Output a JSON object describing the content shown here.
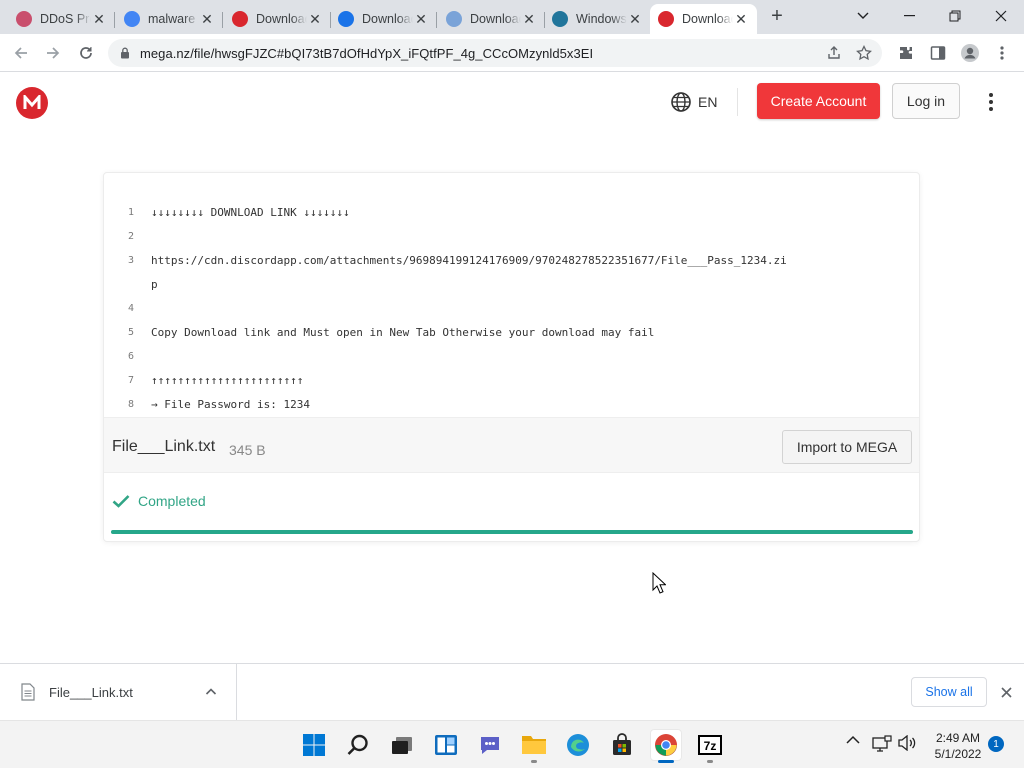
{
  "browser": {
    "tabs": [
      {
        "title": "DDoS Pro",
        "favicon": "ddos-favicon-icon",
        "fav_color": "#c94f6d"
      },
      {
        "title": "malware",
        "favicon": "google-favicon-icon",
        "fav_color": "#4285f4"
      },
      {
        "title": "Download",
        "favicon": "mega-favicon-icon",
        "fav_color": "#d9272e"
      },
      {
        "title": "Download",
        "favicon": "download-favicon-icon",
        "fav_color": "#1a73e8"
      },
      {
        "title": "Download",
        "favicon": "globe-favicon-icon",
        "fav_color": "#7aa3d8"
      },
      {
        "title": "Windows",
        "favicon": "wordpress-favicon-icon",
        "fav_color": "#21759b"
      },
      {
        "title": "Download",
        "favicon": "mega-favicon-icon",
        "fav_color": "#d9272e",
        "active": true
      }
    ],
    "url": "mega.nz/file/hwsgFJZC#bQI73tB7dOfHdYpX_iFQtfPF_4g_CCcOMzynld5x3EI"
  },
  "mega": {
    "language": "EN",
    "create_account": "Create Account",
    "login": "Log in",
    "accent_color": "#f0373a"
  },
  "preview": {
    "lines": [
      {
        "num": "1",
        "text": "↓↓↓↓↓↓↓↓ DOWNLOAD LINK ↓↓↓↓↓↓↓"
      },
      {
        "num": "2",
        "text": ""
      },
      {
        "num": "3",
        "text": "https://cdn.discordapp.com/attachments/969894199124176909/970248278522351677/File___Pass_1234.zi"
      },
      {
        "num": "",
        "text": "p"
      },
      {
        "num": "4",
        "text": ""
      },
      {
        "num": "5",
        "text": "Copy Download link and Must open in New Tab Otherwise your download may fail"
      },
      {
        "num": "6",
        "text": ""
      },
      {
        "num": "7",
        "text": "↑↑↑↑↑↑↑↑↑↑↑↑↑↑↑↑↑↑↑↑↑↑↑"
      },
      {
        "num": "8",
        "text": "→ File Password is: 1234"
      }
    ],
    "file_name": "File___Link.txt",
    "file_size": "345 B",
    "import_label": "Import to MEGA",
    "status": "Completed",
    "progress": 1.0,
    "status_color": "#31a586"
  },
  "downloads": {
    "item_name": "File___Link.txt",
    "show_all": "Show all"
  },
  "taskbar": {
    "apps": [
      "start-icon",
      "search-icon",
      "task-view-icon",
      "widgets-icon",
      "teams-chat-icon",
      "file-explorer-icon",
      "edge-icon",
      "store-icon",
      "chrome-icon",
      "7zip-icon"
    ],
    "time": "2:49 AM",
    "date": "5/1/2022",
    "notifications": "1"
  }
}
